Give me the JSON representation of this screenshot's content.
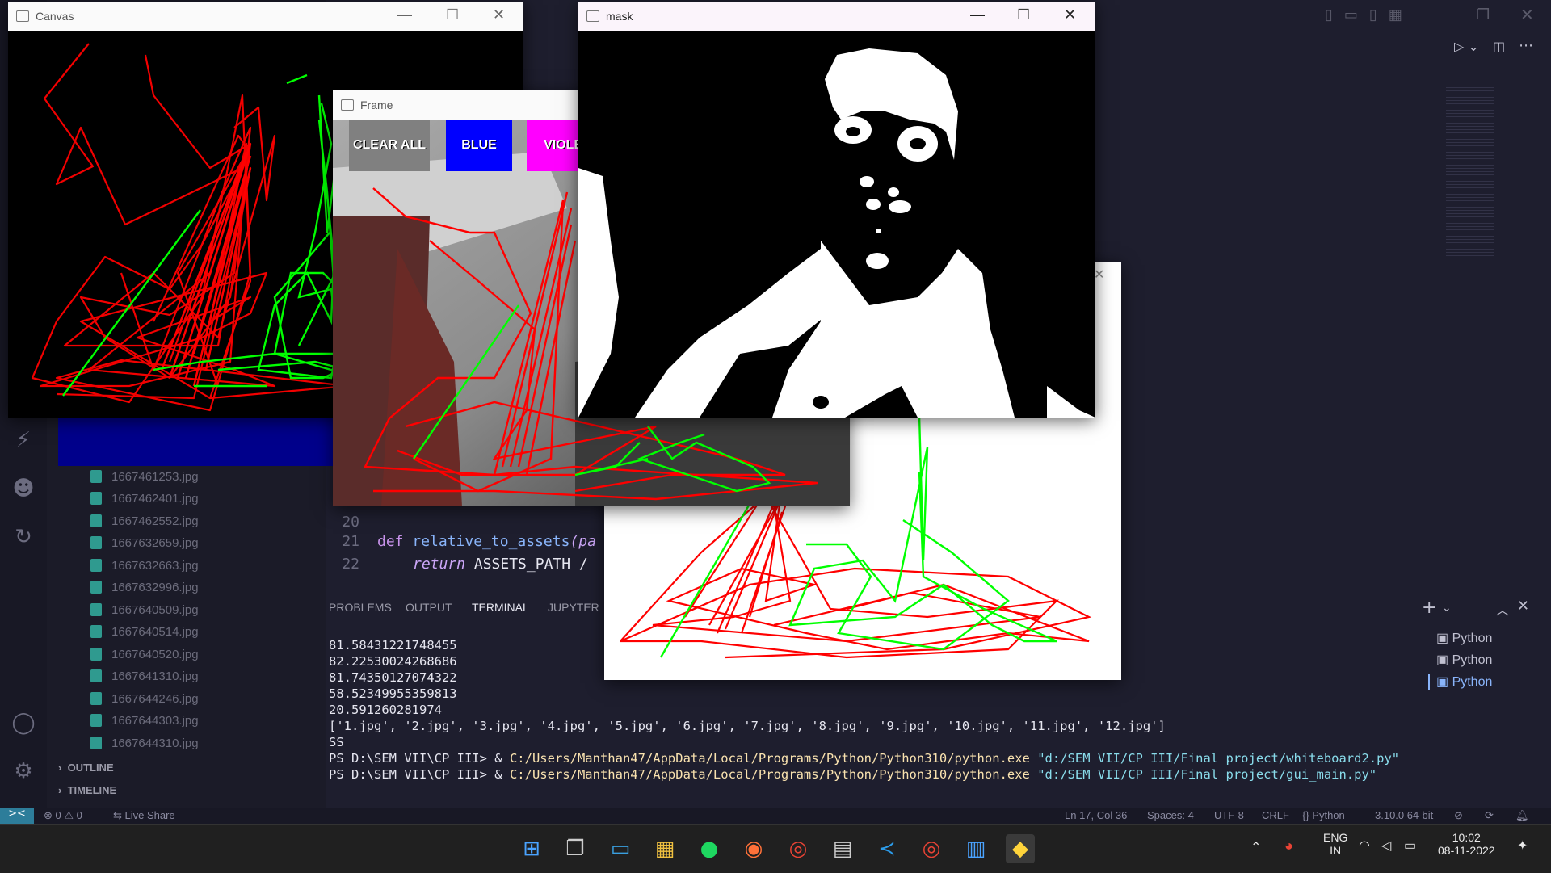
{
  "windows": {
    "canvas": {
      "title": "Canvas"
    },
    "frame": {
      "title": "Frame",
      "buttons": [
        "CLEAR ALL",
        "BLUE",
        "VIOLET"
      ]
    },
    "mask": {
      "title": "mask"
    }
  },
  "explorer": {
    "files": [
      "1667461253.jpg",
      "1667462401.jpg",
      "1667462552.jpg",
      "1667632659.jpg",
      "1667632663.jpg",
      "1667632996.jpg",
      "1667640509.jpg",
      "1667640514.jpg",
      "1667640520.jpg",
      "1667641310.jpg",
      "1667644246.jpg",
      "1667644303.jpg",
      "1667644310.jpg"
    ],
    "outline": "OUTLINE",
    "timeline": "TIMELINE"
  },
  "code": {
    "line20": "20",
    "line21": "21",
    "line22": "22",
    "def_kw": "def",
    "fn_name": "relative_to_assets",
    "fn_rest": "(pa",
    "ret_kw": "return",
    "ret_rest": " ASSETS_PATH /"
  },
  "panel": {
    "tabs": [
      "PROBLEMS",
      "OUTPUT",
      "TERMINAL",
      "JUPYTER"
    ],
    "active_tab": "TERMINAL",
    "terminals": [
      "Python",
      "Python",
      "Python"
    ],
    "lines": [
      "81.58431221748455",
      "82.22530024268686",
      "81.74350127074322",
      "58.52349955359813",
      "20.591260281974",
      "['1.jpg', '2.jpg', '3.jpg', '4.jpg', '5.jpg', '6.jpg', '7.jpg', '8.jpg', '9.jpg', '10.jpg', '11.jpg', '12.jpg']",
      "SS"
    ],
    "cmd1_prompt": "PS D:\\SEM VII\\CP III> & ",
    "cmd1_exe": "C:/Users/Manthan47/AppData/Local/Programs/Python/Python310/python.exe",
    "cmd1_arg": " \"d:/SEM VII/CP III/Final project/whiteboard2.py\"",
    "cmd2_prompt": "PS D:\\SEM VII\\CP III> & ",
    "cmd2_exe": "C:/Users/Manthan47/AppData/Local/Programs/Python/Python310/python.exe",
    "cmd2_arg": " \"d:/SEM VII/CP III/Final project/gui_main.py\""
  },
  "statusbar": {
    "errors": "0",
    "warnings": "0",
    "live_share": "Live Share",
    "position": "Ln 17, Col 36",
    "spaces": "Spaces: 4",
    "encoding": "UTF-8",
    "eol": "CRLF",
    "language": "Python",
    "interpreter": "3.10.0 64-bit"
  },
  "taskbar": {
    "lang1": "ENG",
    "lang2": "IN",
    "time": "10:02",
    "date": "08-11-2022"
  },
  "colors": {
    "red_stroke": "#ff0000",
    "green_stroke": "#00ff00",
    "blue_btn": "#0000ff",
    "violet_btn": "#ff00ff",
    "gray_btn": "#808080"
  }
}
